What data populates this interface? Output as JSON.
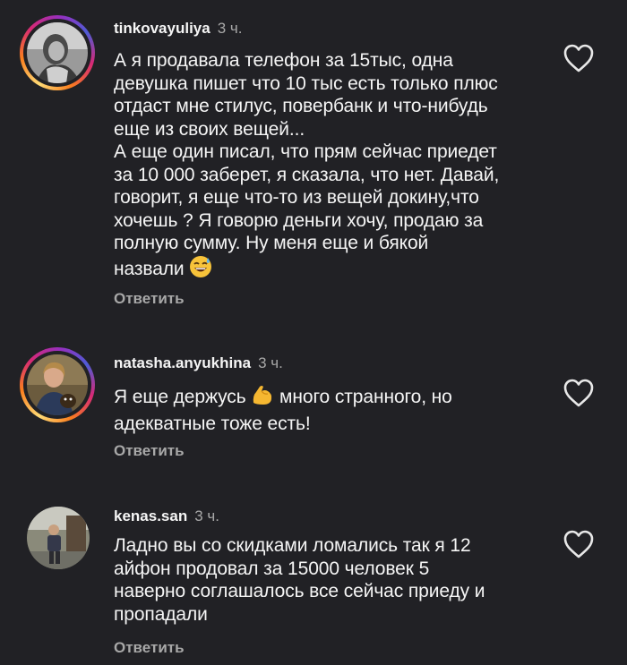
{
  "colors": {
    "background": "#212125",
    "text": "#f5f5f5",
    "muted": "#a8a8a8",
    "story_ring": [
      "#feda75",
      "#fa7e1e",
      "#d62976",
      "#962fbf",
      "#4f5bd5"
    ]
  },
  "comments": [
    {
      "username": "tinkovayuliya",
      "time": "3 ч.",
      "has_story": true,
      "lines": [
        "А я продавала телефон за 15тыс, одна",
        "девушка пишет что 10 тыс есть только плюс",
        "отдаст мне стилус, повербанк и что-нибудь",
        "еще из своих вещей...",
        "А еще один писал, что прям сейчас приедет",
        "за 10 000 заберет, я сказала, что нет. Давай,",
        "говорит, я еще что-то из вещей докину,что",
        "хочешь ? Я говорю деньги хочу, продаю за",
        "полную сумму. Ну меня еще и бякой",
        "назвали"
      ],
      "emoji": "sweat-smile-emoji",
      "reply_label": "Ответить",
      "like_icon": "heart-outline-icon"
    },
    {
      "username": "natasha.anyukhina",
      "time": "3 ч.",
      "has_story": true,
      "text_before_emoji": "Я еще держусь",
      "emoji": "flexed-biceps-emoji",
      "text_after_emoji": "много странного, но",
      "line2": "адекватные тоже есть!",
      "reply_label": "Ответить",
      "like_icon": "heart-outline-icon"
    },
    {
      "username": "kenas.san",
      "time": "3 ч.",
      "has_story": false,
      "lines": [
        "Ладно вы со скидками ломались так я 12",
        "айфон продовал за 15000 человек 5",
        "наверно соглашалось все сейчас приеду и",
        "пропадали"
      ],
      "reply_label": "Ответить",
      "like_icon": "heart-outline-icon"
    }
  ]
}
